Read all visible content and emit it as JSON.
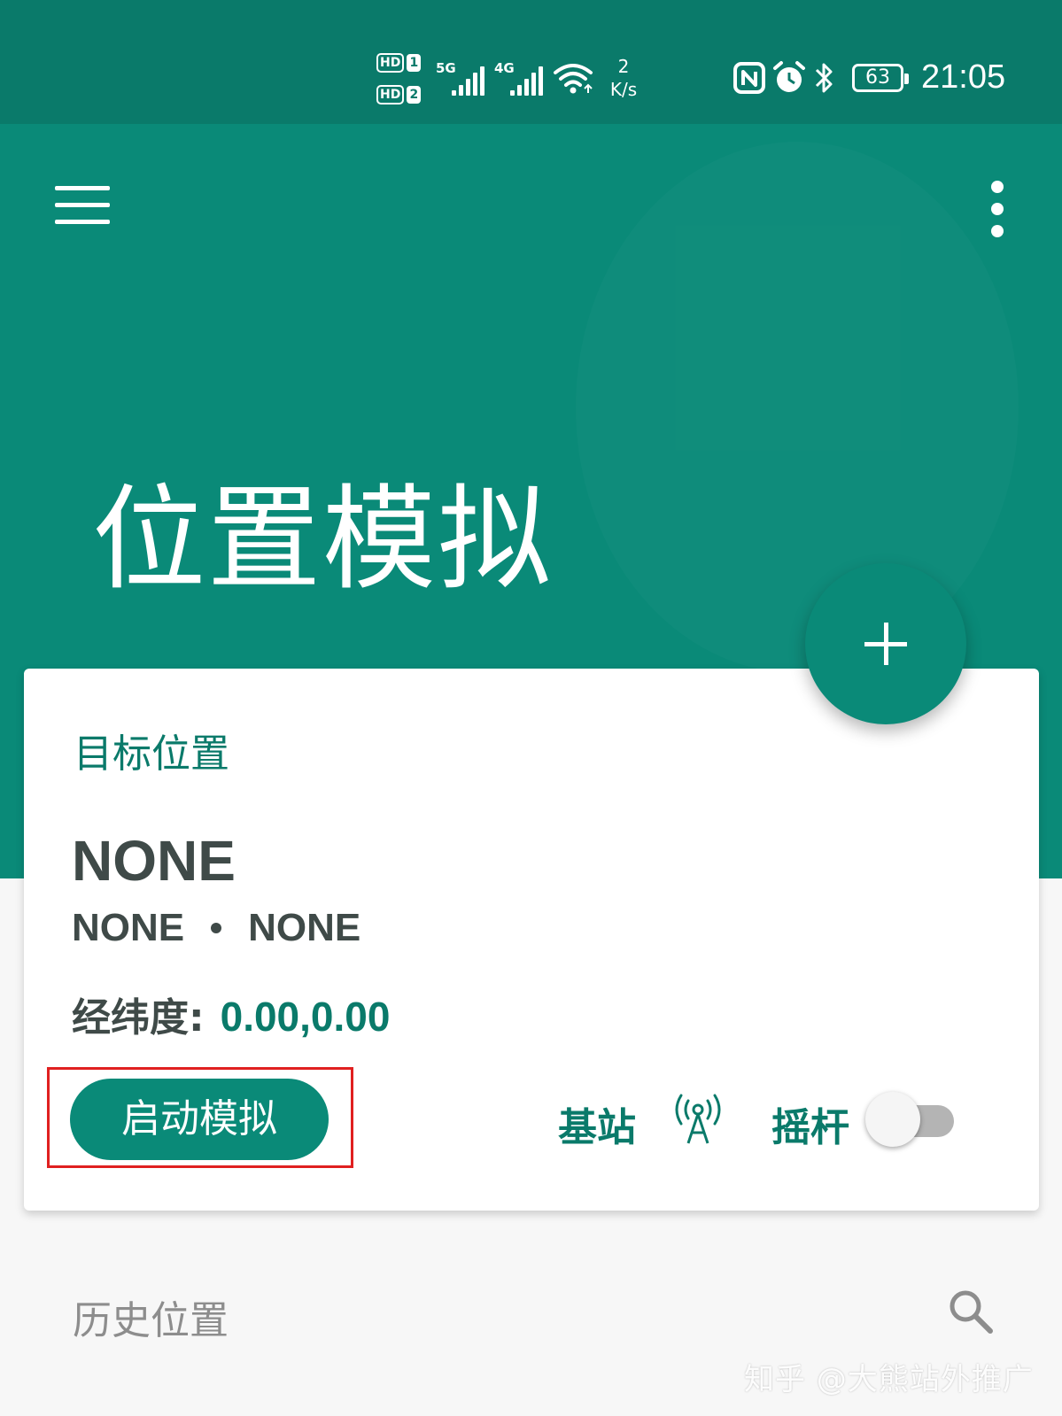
{
  "status_bar": {
    "sim1": {
      "badge": "HD",
      "slot": "1"
    },
    "sim2": {
      "badge": "HD",
      "slot": "2"
    },
    "network_1": "5G",
    "network_2": "4G",
    "speed_value": "2",
    "speed_unit": "K/s",
    "battery": "63",
    "time": "21:05",
    "icons": [
      "nfc-icon",
      "alarm-icon",
      "bluetooth-icon",
      "battery-icon"
    ]
  },
  "header": {
    "title": "位置模拟",
    "menu_icon": "menu-icon",
    "more_icon": "more-vert-icon"
  },
  "card": {
    "label": "目标位置",
    "location_name": "NONE",
    "location_region": "NONE",
    "location_city": "NONE",
    "coords_label": "经纬度:",
    "coords_value": "0.00,0.00",
    "start_button": "启动模拟",
    "station_label": "基站",
    "joystick_label": "摇杆",
    "joystick_enabled": false
  },
  "fab": {
    "icon": "plus-icon"
  },
  "history": {
    "label": "历史位置",
    "search_icon": "search-icon"
  },
  "watermark": "知乎 @大熊站外推广",
  "colors": {
    "primary": "#0a8a78",
    "status_bar": "#0a7a6a",
    "text_dark": "#3f4a48",
    "highlight": "#e02020"
  }
}
